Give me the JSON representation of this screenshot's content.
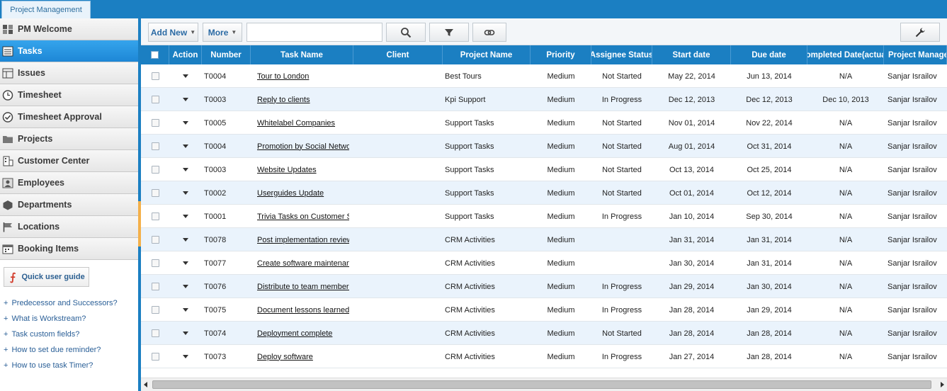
{
  "app_tab": "Project Management",
  "sidebar": {
    "items": [
      {
        "label": "PM Welcome",
        "icon": "dashboard-icon",
        "active": false
      },
      {
        "label": "Tasks",
        "icon": "list-icon",
        "active": true
      },
      {
        "label": "Issues",
        "icon": "grid-icon",
        "active": false
      },
      {
        "label": "Timesheet",
        "icon": "clock-icon",
        "active": false
      },
      {
        "label": "Timesheet Approval",
        "icon": "check-circle-icon",
        "active": false
      },
      {
        "label": "Projects",
        "icon": "folder-icon",
        "active": false
      },
      {
        "label": "Customer Center",
        "icon": "building-icon",
        "active": false
      },
      {
        "label": "Employees",
        "icon": "people-icon",
        "active": false
      },
      {
        "label": "Departments",
        "icon": "cube-icon",
        "active": false
      },
      {
        "label": "Locations",
        "icon": "flag-icon",
        "active": false
      },
      {
        "label": "Booking Items",
        "icon": "calendar-icon",
        "active": false
      }
    ],
    "guide_button": "Quick user guide",
    "help_links": [
      "Predecessor and Successors?",
      "What is Workstream?",
      "Task custom fields?",
      "How to set due reminder?",
      "How to use task Timer?"
    ]
  },
  "toolbar": {
    "add_new": "Add New",
    "more": "More",
    "search_value": ""
  },
  "columns": [
    "Action",
    "Number",
    "Task Name",
    "Client",
    "Project Name",
    "Priority",
    "Assignee Status",
    "Start date",
    "Due date",
    "Completed Date(actual)",
    "Project Manager"
  ],
  "rows": [
    {
      "number": "T0004",
      "task": "Tour to London",
      "client": "",
      "project": "Best Tours",
      "priority": "Medium",
      "status": "Not Started",
      "start": "May 22, 2014",
      "due": "Jun 13, 2014",
      "completed": "N/A",
      "manager": "Sanjar Israilov"
    },
    {
      "number": "T0003",
      "task": "Reply to clients",
      "client": "",
      "project": "Kpi Support",
      "priority": "Medium",
      "status": "In Progress",
      "start": "Dec 12, 2013",
      "due": "Dec 12, 2013",
      "completed": "Dec 10, 2013",
      "manager": "Sanjar Israilov"
    },
    {
      "number": "T0005",
      "task": "Whitelabel Companies",
      "client": "",
      "project": "Support Tasks",
      "priority": "Medium",
      "status": "Not Started",
      "start": "Nov 01, 2014",
      "due": "Nov 22, 2014",
      "completed": "N/A",
      "manager": "Sanjar Israilov"
    },
    {
      "number": "T0004",
      "task": "Promotion by Social Networ",
      "client": "",
      "project": "Support Tasks",
      "priority": "Medium",
      "status": "Not Started",
      "start": "Aug 01, 2014",
      "due": "Oct 31, 2014",
      "completed": "N/A",
      "manager": "Sanjar Israilov"
    },
    {
      "number": "T0003",
      "task": "Website Updates",
      "client": "",
      "project": "Support Tasks",
      "priority": "Medium",
      "status": "Not Started",
      "start": "Oct 13, 2014",
      "due": "Oct 25, 2014",
      "completed": "N/A",
      "manager": "Sanjar Israilov"
    },
    {
      "number": "T0002",
      "task": "Userguides Update",
      "client": "",
      "project": "Support Tasks",
      "priority": "Medium",
      "status": "Not Started",
      "start": "Oct 01, 2014",
      "due": "Oct 12, 2014",
      "completed": "N/A",
      "manager": "Sanjar Israilov"
    },
    {
      "number": "T0001",
      "task": "Trivia Tasks on Customer S",
      "client": "",
      "project": "Support Tasks",
      "priority": "Medium",
      "status": "In Progress",
      "start": "Jan 10, 2014",
      "due": "Sep 30, 2014",
      "completed": "N/A",
      "manager": "Sanjar Israilov"
    },
    {
      "number": "T0078",
      "task": "Post implementation review",
      "client": "",
      "project": "CRM Activities",
      "priority": "Medium",
      "status": "",
      "start": "Jan 31, 2014",
      "due": "Jan 31, 2014",
      "completed": "N/A",
      "manager": "Sanjar Israilov"
    },
    {
      "number": "T0077",
      "task": "Create software maintenan",
      "client": "",
      "project": "CRM Activities",
      "priority": "Medium",
      "status": "",
      "start": "Jan 30, 2014",
      "due": "Jan 31, 2014",
      "completed": "N/A",
      "manager": "Sanjar Israilov"
    },
    {
      "number": "T0076",
      "task": "Distribute to team members",
      "client": "",
      "project": "CRM Activities",
      "priority": "Medium",
      "status": "In Progress",
      "start": "Jan 29, 2014",
      "due": "Jan 30, 2014",
      "completed": "N/A",
      "manager": "Sanjar Israilov"
    },
    {
      "number": "T0075",
      "task": "Document lessons learned",
      "client": "",
      "project": "CRM Activities",
      "priority": "Medium",
      "status": "In Progress",
      "start": "Jan 28, 2014",
      "due": "Jan 29, 2014",
      "completed": "N/A",
      "manager": "Sanjar Israilov"
    },
    {
      "number": "T0074",
      "task": "Deployment complete",
      "client": "",
      "project": "CRM Activities",
      "priority": "Medium",
      "status": "Not Started",
      "start": "Jan 28, 2014",
      "due": "Jan 28, 2014",
      "completed": "N/A",
      "manager": "Sanjar Israilov"
    },
    {
      "number": "T0073",
      "task": "Deploy software",
      "client": "",
      "project": "CRM Activities",
      "priority": "Medium",
      "status": "In Progress",
      "start": "Jan 27, 2014",
      "due": "Jan 28, 2014",
      "completed": "N/A",
      "manager": "Sanjar Israilov"
    }
  ],
  "colors": {
    "accent": "#1b7fc2",
    "row_alt": "#eaf3fc",
    "link": "#2a5f97"
  }
}
